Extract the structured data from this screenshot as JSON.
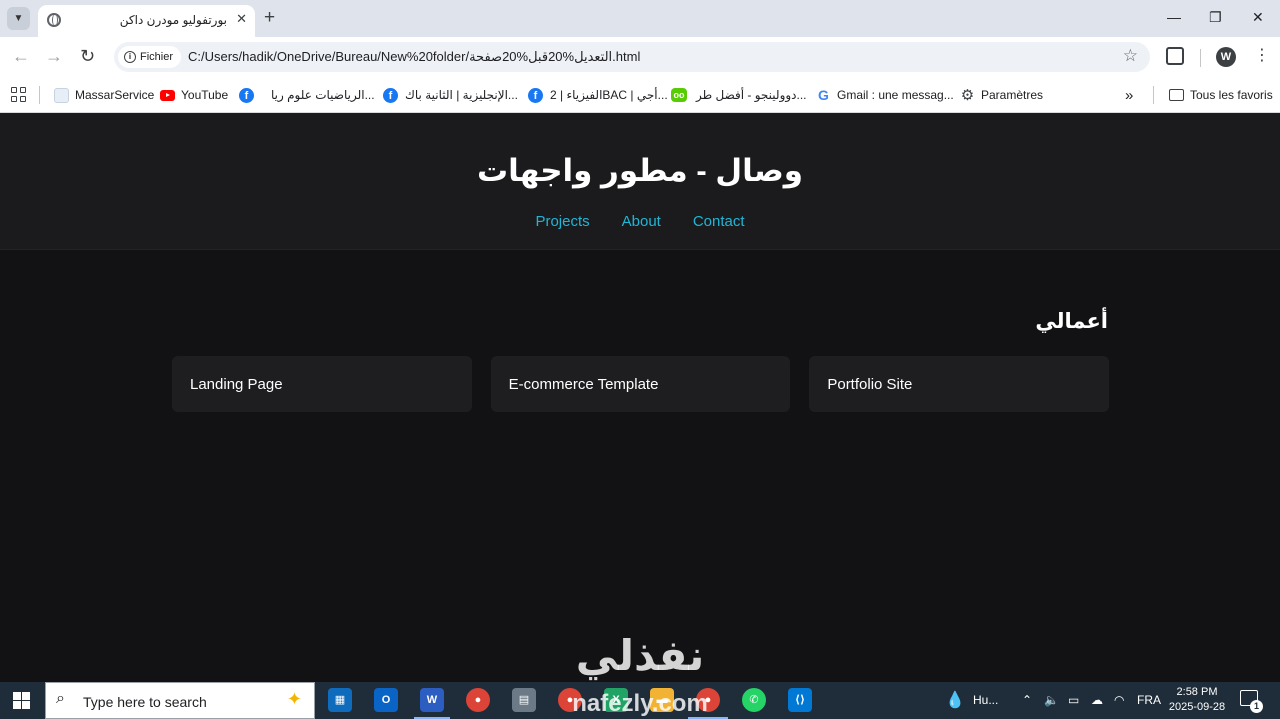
{
  "browser": {
    "tab_title": "بورتفوليو مودرن داكن",
    "tab_close": "✕",
    "new_tab": "+",
    "window_controls": {
      "minimize": "—",
      "restore": "❐",
      "close": "✕"
    },
    "chip_label": "Fichier",
    "url": "C:/Users/hadik/OneDrive/Bureau/New%20folder/التعديل%20قبل%20صفحة.html",
    "profile_initial": "W",
    "bookmarks": [
      {
        "label": "MassarService",
        "icon": "massar-icon"
      },
      {
        "label": "YouTube",
        "icon": "youtube-icon"
      },
      {
        "label": "الرياضيات علوم ريا...",
        "icon": "facebook-icon"
      },
      {
        "label": "الإنجليزية | الثانية باك...",
        "icon": "facebook-icon"
      },
      {
        "label": "الفيزياء | 2BAC | أجي...",
        "icon": "facebook-icon"
      },
      {
        "label": "دوولينجو - أفضل طر...",
        "icon": "duolingo-icon"
      },
      {
        "label": "Gmail : une messag...",
        "icon": "google-icon"
      },
      {
        "label": "Paramètres",
        "icon": "gear-icon"
      }
    ],
    "bookmarks_overflow": "»",
    "all_bookmarks": "Tous les favoris"
  },
  "page": {
    "title": "وصال - مطور واجهات",
    "nav": [
      "Projects",
      "About",
      "Contact"
    ],
    "section_title": "أعمالي",
    "cards": [
      "Landing Page",
      "E-commerce Template",
      "Portfolio Site"
    ]
  },
  "watermark": {
    "arabic": "نفذلي",
    "latin": "nafezly.com"
  },
  "taskbar": {
    "search_placeholder": "Type here to search",
    "weather": "Hu...",
    "language": "FRA",
    "time": "2:58 PM",
    "date": "2025-09-28",
    "notification_count": "1"
  },
  "colors": {
    "page_bg": "#121214",
    "header_bg": "#1b1b1d",
    "card_bg": "#1e1e21",
    "nav_link": "#1fb6d6",
    "taskbar_bg": "#1f2d3a"
  }
}
